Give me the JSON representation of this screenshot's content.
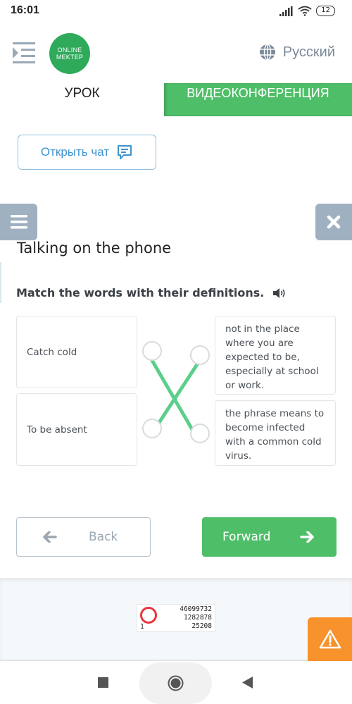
{
  "status_bar": {
    "time": "16:01",
    "battery": "12",
    "icons": [
      "signal-icon",
      "wifi-icon",
      "battery-icon"
    ]
  },
  "header": {
    "logo_line1": "ONLINE",
    "logo_line2": "MEKTEP",
    "language": "Русский"
  },
  "tabs": [
    {
      "label": "УРОК",
      "active": false
    },
    {
      "label": "ВИДЕОКОНФЕРЕНЦИЯ",
      "active": true
    }
  ],
  "chat_button": {
    "label": "Открыть чат"
  },
  "lesson": {
    "title": "Talking on the phone",
    "task": "Match the words with their definitions."
  },
  "matching": {
    "words": [
      "Catch cold",
      "To be absent"
    ],
    "definitions": [
      "not in the place where you are expected to be, especially at school or work.",
      "the phrase means to become infected with a common cold virus."
    ],
    "connections": [
      {
        "word": 0,
        "definition": 1
      },
      {
        "word": 1,
        "definition": 0
      }
    ],
    "line_color": "#5bcf8a"
  },
  "navigation": {
    "back_label": "Back",
    "forward_label": "Forward"
  },
  "counter": {
    "line1": "46099732",
    "line2": "1282878",
    "line3": "25208",
    "left_number": "1"
  },
  "colors": {
    "brand_green": "#4fbe68",
    "logo_green": "#2faa5a",
    "chat_blue": "#3d92cf",
    "control_gray": "#9fb1c0",
    "warning_orange": "#f7922c"
  }
}
